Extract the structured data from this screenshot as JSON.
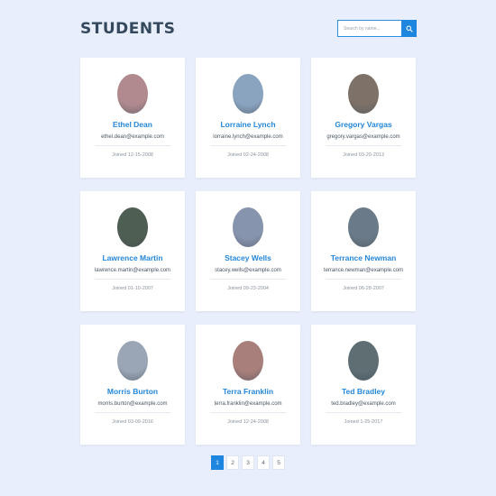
{
  "header": {
    "title": "STUDENTS",
    "search_placeholder": "Search by name..."
  },
  "colors": {
    "accent": "#1f86e0",
    "name_text": "#2487d8",
    "title_text": "#34495e",
    "background": "#e8eefb"
  },
  "icons": {
    "search": "search-icon"
  },
  "students": [
    {
      "name": "Ethel Dean",
      "email": "ethel.dean@example.com",
      "joined": "Joined 12-15-2008",
      "avatar_color": "#b08a8e"
    },
    {
      "name": "Lorraine Lynch",
      "email": "lorraine.lynch@example.com",
      "joined": "Joined 02-24-2008",
      "avatar_color": "#8aa3bf"
    },
    {
      "name": "Gregory Vargas",
      "email": "gregory.vargas@example.com",
      "joined": "Joined 03-20-2013",
      "avatar_color": "#7d7168"
    },
    {
      "name": "Lawrence Martin",
      "email": "lawrence.martin@example.com",
      "joined": "Joined 01-10-2007",
      "avatar_color": "#4f5e52"
    },
    {
      "name": "Stacey Wells",
      "email": "stacey.wells@example.com",
      "joined": "Joined 09-23-2004",
      "avatar_color": "#8794ad"
    },
    {
      "name": "Terrance Newman",
      "email": "terrance.newman@example.com",
      "joined": "Joined 06-28-2007",
      "avatar_color": "#6b7a88"
    },
    {
      "name": "Morris Burton",
      "email": "morris.burton@example.com",
      "joined": "Joined 03-09-2016",
      "avatar_color": "#9aa6b5"
    },
    {
      "name": "Terra Franklin",
      "email": "terra.franklin@example.com",
      "joined": "Joined 12-24-2008",
      "avatar_color": "#a87f7a"
    },
    {
      "name": "Ted Bradley",
      "email": "ted.bradley@example.com",
      "joined": "Joined 1-25-2017",
      "avatar_color": "#5e6e73"
    }
  ],
  "pagination": {
    "pages": [
      "1",
      "2",
      "3",
      "4",
      "5"
    ],
    "current": "1"
  }
}
